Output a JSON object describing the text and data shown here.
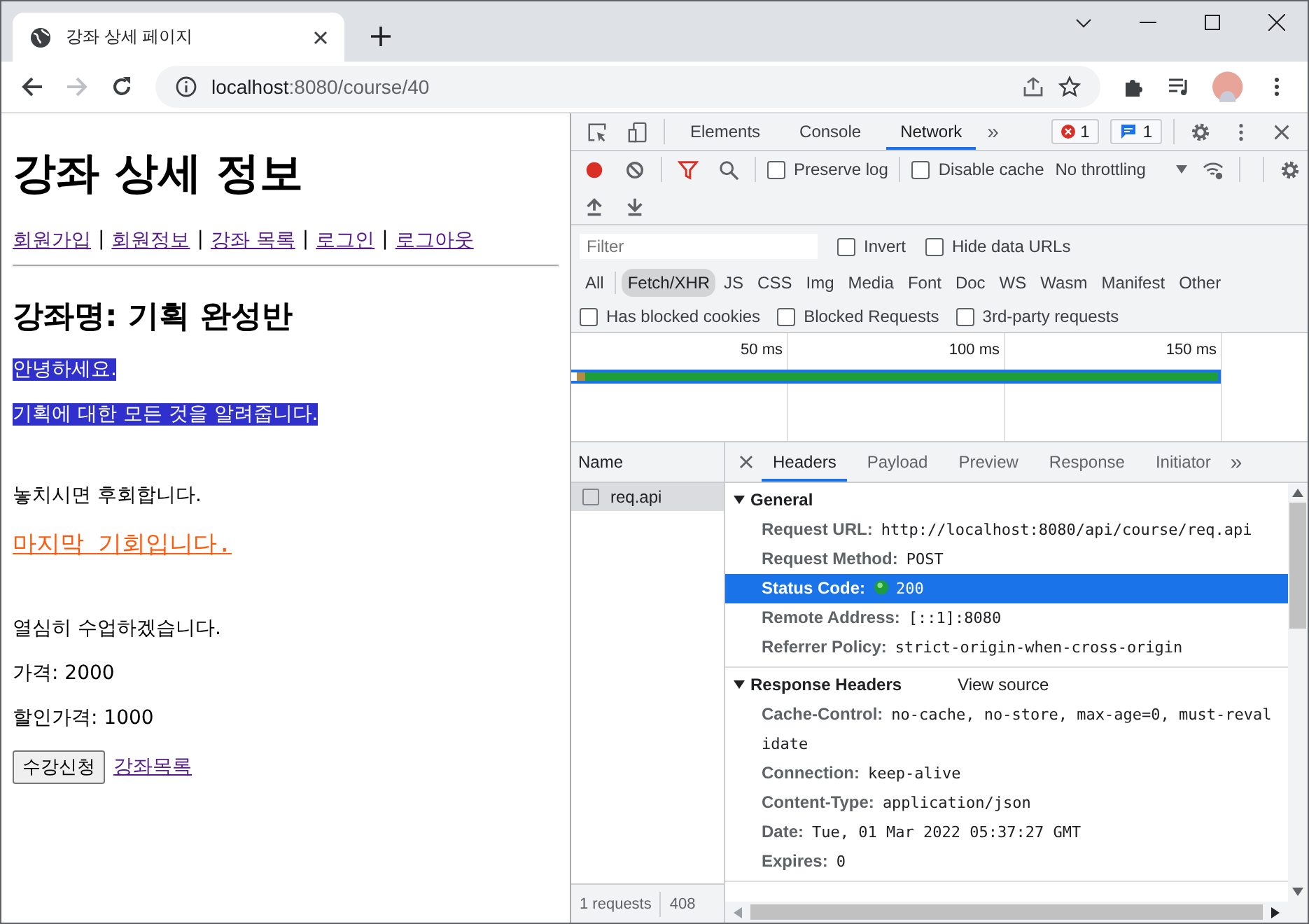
{
  "browser": {
    "tab_title": "강좌 상세 페이지",
    "url_host": "localhost",
    "url_rest": ":8080/course/40"
  },
  "page": {
    "title": "강좌 상세 정보",
    "nav": [
      {
        "label": "회원가입"
      },
      {
        "separator": "|",
        "label": "회원정보"
      },
      {
        "separator": "|",
        "label": "강좌 목록"
      },
      {
        "separator": "|",
        "label": "로그인"
      },
      {
        "separator": "|",
        "label": "로그아웃"
      }
    ],
    "course_name": "강좌명: 기획 완성반",
    "paragraphs": [
      {
        "kind": "highlight",
        "text": "안녕하세요."
      },
      {
        "kind": "highlight",
        "text": "기획에 대한 모든 것을 알려줍니다."
      },
      {
        "kind": "plain",
        "text": "놓치시면 후회합니다."
      },
      {
        "kind": "emphasis",
        "text": "마지막 기회입니다."
      },
      {
        "kind": "plain",
        "text": "열심히 수업하겠습니다."
      },
      {
        "kind": "plain",
        "text": "가격: 2000"
      },
      {
        "kind": "plain",
        "text": "할인가격: 1000"
      }
    ],
    "enroll_button": "수강신청",
    "list_link": "강좌목록"
  },
  "devtools": {
    "tabs": [
      {
        "label": "Elements",
        "selected": false
      },
      {
        "label": "Console",
        "selected": false
      },
      {
        "label": "Network",
        "selected": true
      }
    ],
    "more_tabs": "»",
    "error_count": "1",
    "message_count": "1",
    "preserve_log": {
      "label": "Preserve log",
      "checked": false
    },
    "disable_cache": {
      "label": "Disable cache",
      "checked": false
    },
    "throttling": "No throttling",
    "filter": {
      "placeholder": "Filter"
    },
    "invert": {
      "label": "Invert",
      "checked": false
    },
    "hide_data_urls": {
      "label": "Hide data URLs",
      "checked": false
    },
    "types": [
      {
        "label": "All",
        "selected": false
      },
      {
        "label": "Fetch/XHR",
        "selected": true
      },
      {
        "label": "JS",
        "selected": false
      },
      {
        "label": "CSS",
        "selected": false
      },
      {
        "label": "Img",
        "selected": false
      },
      {
        "label": "Media",
        "selected": false
      },
      {
        "label": "Font",
        "selected": false
      },
      {
        "label": "Doc",
        "selected": false
      },
      {
        "label": "WS",
        "selected": false
      },
      {
        "label": "Wasm",
        "selected": false
      },
      {
        "label": "Manifest",
        "selected": false
      },
      {
        "label": "Other",
        "selected": false
      }
    ],
    "extra_filters": [
      {
        "label": "Has blocked cookies",
        "checked": false
      },
      {
        "label": "Blocked Requests",
        "checked": false
      },
      {
        "label": "3rd-party requests",
        "checked": false
      }
    ],
    "timeline_ticks": [
      "50 ms",
      "100 ms",
      "150 ms"
    ],
    "requests": {
      "header": "Name",
      "rows": [
        {
          "name": "req.api",
          "selected": true
        }
      ],
      "summary": "1 requests",
      "transferred": "408"
    },
    "detail_tabs": [
      {
        "label": "Headers",
        "selected": true
      },
      {
        "label": "Payload",
        "selected": false
      },
      {
        "label": "Preview",
        "selected": false
      },
      {
        "label": "Response",
        "selected": false
      },
      {
        "label": "Initiator",
        "selected": false
      }
    ],
    "sections": [
      {
        "title": "General",
        "expanded": true,
        "rows": [
          {
            "key": "Request URL:",
            "value": "http://localhost:8080/api/course/req.api",
            "selected": false
          },
          {
            "key": "Request Method:",
            "value": "POST",
            "selected": false
          },
          {
            "key": "Status Code:",
            "value": "200",
            "selected": true,
            "kind": "status"
          },
          {
            "key": "Remote Address:",
            "value": "[::1]:8080",
            "selected": false
          },
          {
            "key": "Referrer Policy:",
            "value": "strict-origin-when-cross-origin",
            "selected": false
          }
        ]
      },
      {
        "title": "Response Headers",
        "expanded": true,
        "link": "View source",
        "rows": [
          {
            "key": "Cache-Control:",
            "value": "no-cache, no-store, max-age=0, must-revalidate",
            "selected": false
          },
          {
            "key": "Connection:",
            "value": "keep-alive",
            "selected": false
          },
          {
            "key": "Content-Type:",
            "value": "application/json",
            "selected": false
          },
          {
            "key": "Date:",
            "value": "Tue, 01 Mar 2022 05:37:27 GMT",
            "selected": false
          },
          {
            "key": "Expires:",
            "value": "0",
            "selected": false
          }
        ]
      }
    ]
  }
}
